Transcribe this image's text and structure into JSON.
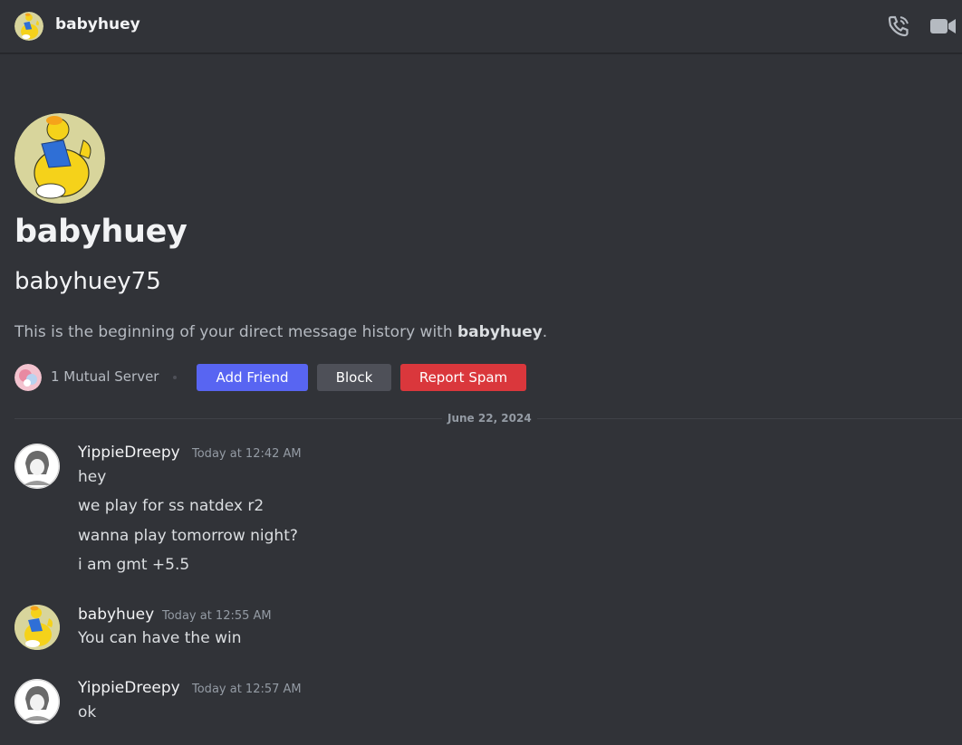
{
  "header": {
    "name": "babyhuey",
    "call_icon": "phone-call-icon",
    "video_icon": "video-camera-icon"
  },
  "profile": {
    "display_name": "babyhuey",
    "username": "babyhuey75",
    "intro_prefix": "This is the beginning of your direct message history with ",
    "intro_name": "babyhuey",
    "intro_suffix": ".",
    "mutual_servers": "1 Mutual Server",
    "buttons": {
      "add_friend": "Add Friend",
      "block": "Block",
      "report_spam": "Report Spam"
    }
  },
  "divider": {
    "date": "June 22, 2024"
  },
  "messages": [
    {
      "author": "YippieDreepy",
      "time": "Today at 12:42 AM",
      "lines": [
        "hey",
        "we play for ss natdex r2",
        "wanna play tomorrow night?",
        "i am gmt +5.5"
      ]
    },
    {
      "author": "babyhuey",
      "time": "Today at 12:55 AM",
      "lines": [
        "You can have the win"
      ]
    },
    {
      "author": "YippieDreepy",
      "time": "Today at 12:57 AM",
      "lines": [
        "ok"
      ]
    }
  ],
  "colors": {
    "background": "#313338",
    "accent": "#5865f2",
    "danger": "#da373c",
    "secondary": "#4e5058"
  }
}
